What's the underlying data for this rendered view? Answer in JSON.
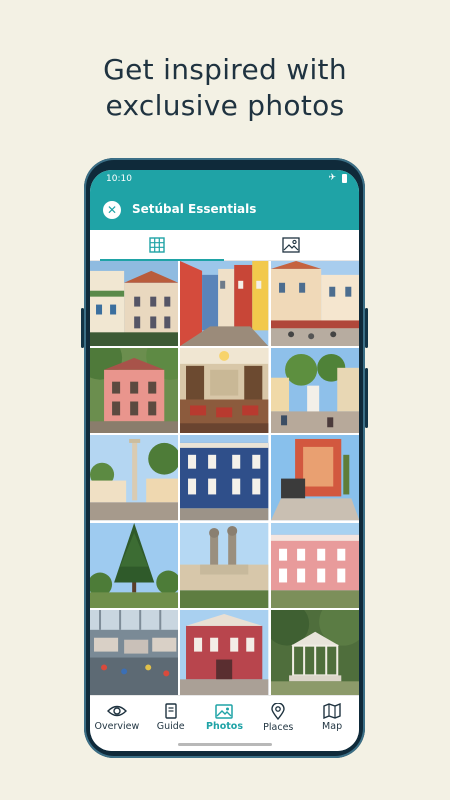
{
  "headline": {
    "line1": "Get inspired with",
    "line2": "exclusive photos"
  },
  "status_bar": {
    "time": "10:10"
  },
  "app_bar": {
    "title": "Setúbal Essentials"
  },
  "tabs": [
    {
      "icon": "grid-icon",
      "active": true
    },
    {
      "icon": "image-icon",
      "active": false
    }
  ],
  "photos": [
    {
      "icon": "photo-townhouses"
    },
    {
      "icon": "photo-colorful-street"
    },
    {
      "icon": "photo-street-cafe"
    },
    {
      "icon": "photo-pink-building"
    },
    {
      "icon": "photo-interior-hall"
    },
    {
      "icon": "photo-sculpture-square"
    },
    {
      "icon": "photo-monument-column"
    },
    {
      "icon": "photo-blue-building"
    },
    {
      "icon": "photo-modern-building"
    },
    {
      "icon": "photo-pine-tree"
    },
    {
      "icon": "photo-fountain"
    },
    {
      "icon": "photo-pink-facade"
    },
    {
      "icon": "photo-market-hall"
    },
    {
      "icon": "photo-red-palace"
    },
    {
      "icon": "photo-bandstand"
    }
  ],
  "bottom_nav": [
    {
      "label": "Overview",
      "icon": "eye-icon",
      "active": false
    },
    {
      "label": "Guide",
      "icon": "book-icon",
      "active": false
    },
    {
      "label": "Photos",
      "icon": "photos-icon",
      "active": true
    },
    {
      "label": "Places",
      "icon": "pin-icon",
      "active": false
    },
    {
      "label": "Map",
      "icon": "map-icon",
      "active": false
    }
  ],
  "colors": {
    "accent": "#1fa3a6",
    "background": "#f3f1e4",
    "headline": "#1f3340",
    "phone_frame": "#0f2a3a"
  }
}
